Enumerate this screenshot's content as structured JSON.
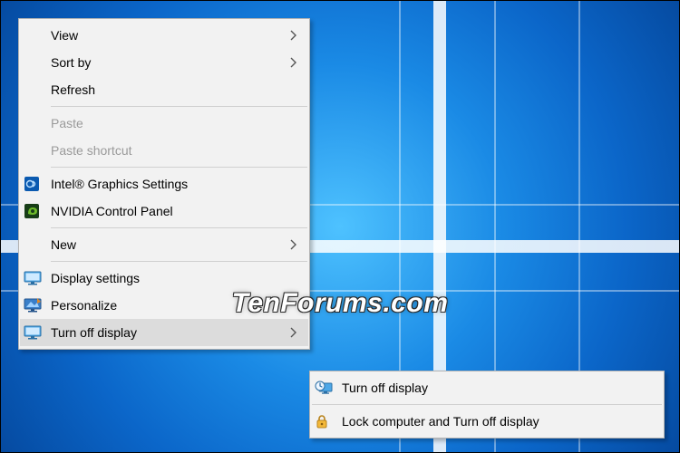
{
  "watermark": "TenForums.com",
  "main_menu": {
    "view": {
      "label": "View",
      "arrow": true,
      "disabled": false,
      "icon": null
    },
    "sort_by": {
      "label": "Sort by",
      "arrow": true,
      "disabled": false,
      "icon": null
    },
    "refresh": {
      "label": "Refresh",
      "arrow": false,
      "disabled": false,
      "icon": null
    },
    "paste": {
      "label": "Paste",
      "arrow": false,
      "disabled": true,
      "icon": null
    },
    "paste_shortcut": {
      "label": "Paste shortcut",
      "arrow": false,
      "disabled": true,
      "icon": null
    },
    "intel_gfx": {
      "label": "Intel® Graphics Settings",
      "arrow": false,
      "disabled": false,
      "icon": "intel"
    },
    "nvidia_cp": {
      "label": "NVIDIA Control Panel",
      "arrow": false,
      "disabled": false,
      "icon": "nvidia"
    },
    "new": {
      "label": "New",
      "arrow": true,
      "disabled": false,
      "icon": null
    },
    "display_settings": {
      "label": "Display settings",
      "arrow": false,
      "disabled": false,
      "icon": "monitor"
    },
    "personalize": {
      "label": "Personalize",
      "arrow": false,
      "disabled": false,
      "icon": "personalize"
    },
    "turn_off_display": {
      "label": "Turn off display",
      "arrow": true,
      "disabled": false,
      "icon": "monitor-off",
      "highlight": true
    }
  },
  "sub_menu": {
    "turn_off": {
      "label": "Turn off display",
      "icon": "clock-monitor"
    },
    "lock_off": {
      "label": "Lock computer and Turn off display",
      "icon": "lock"
    }
  }
}
